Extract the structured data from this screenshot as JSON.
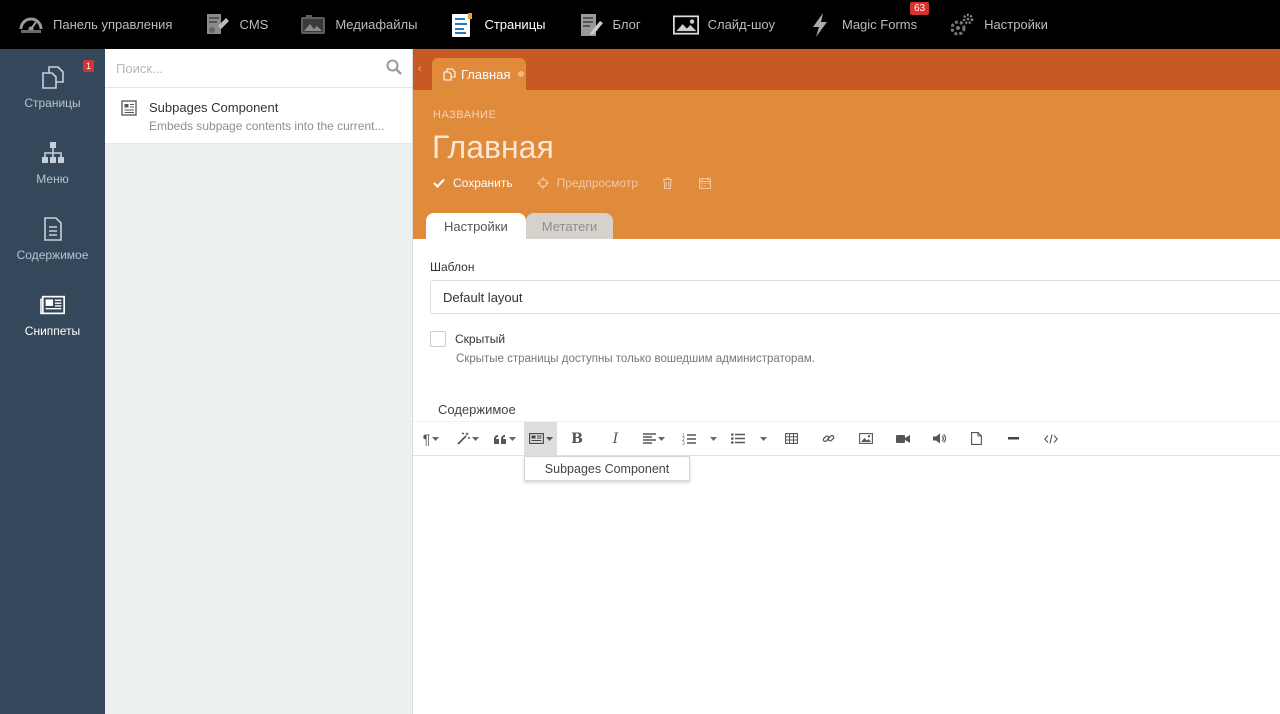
{
  "topnav": {
    "items": [
      {
        "label": "Панель управления",
        "icon": "dashboard-icon",
        "active": false
      },
      {
        "label": "CMS",
        "icon": "cms-icon",
        "active": false
      },
      {
        "label": "Медиафайлы",
        "icon": "media-icon",
        "active": false
      },
      {
        "label": "Страницы",
        "icon": "pages-icon",
        "active": true
      },
      {
        "label": "Блог",
        "icon": "blog-icon",
        "active": false
      },
      {
        "label": "Слайд-шоу",
        "icon": "slideshow-icon",
        "active": false
      },
      {
        "label": "Magic Forms",
        "icon": "lightning-icon",
        "active": false,
        "badge": "63"
      },
      {
        "label": "Настройки",
        "icon": "gears-icon",
        "active": false
      }
    ]
  },
  "sidebar": {
    "items": [
      {
        "label": "Страницы",
        "icon": "pages-copy-icon",
        "badge": "1",
        "active": false
      },
      {
        "label": "Меню",
        "icon": "sitemap-icon",
        "active": false
      },
      {
        "label": "Содержимое",
        "icon": "file-text-icon",
        "active": false
      },
      {
        "label": "Сниппеты",
        "icon": "newspaper-icon",
        "active": true
      }
    ]
  },
  "panel": {
    "search_placeholder": "Поиск...",
    "components": [
      {
        "title": "Subpages Component",
        "description": "Embeds subpage contents into the current..."
      }
    ]
  },
  "editor": {
    "doc_tab": "Главная",
    "name_label": "НАЗВАНИЕ",
    "title": "Главная",
    "save_label": "Сохранить",
    "preview_label": "Предпросмотр",
    "tabs": [
      "Настройки",
      "Метатеги"
    ],
    "template_label": "Шаблон",
    "template_value": "Default layout",
    "hidden_label": "Скрытый",
    "hidden_help": "Скрытые страницы доступны только вошедшим администраторам.",
    "content_tab": "Содержимое",
    "snippet_dropdown_item": "Subpages Component"
  },
  "colors": {
    "topnav_bg": "#000000",
    "sidebar_bg": "#35485b",
    "header_orange": "#e08a3c",
    "tabstrip_orange": "#c75a24",
    "badge_red": "#d6322f"
  }
}
